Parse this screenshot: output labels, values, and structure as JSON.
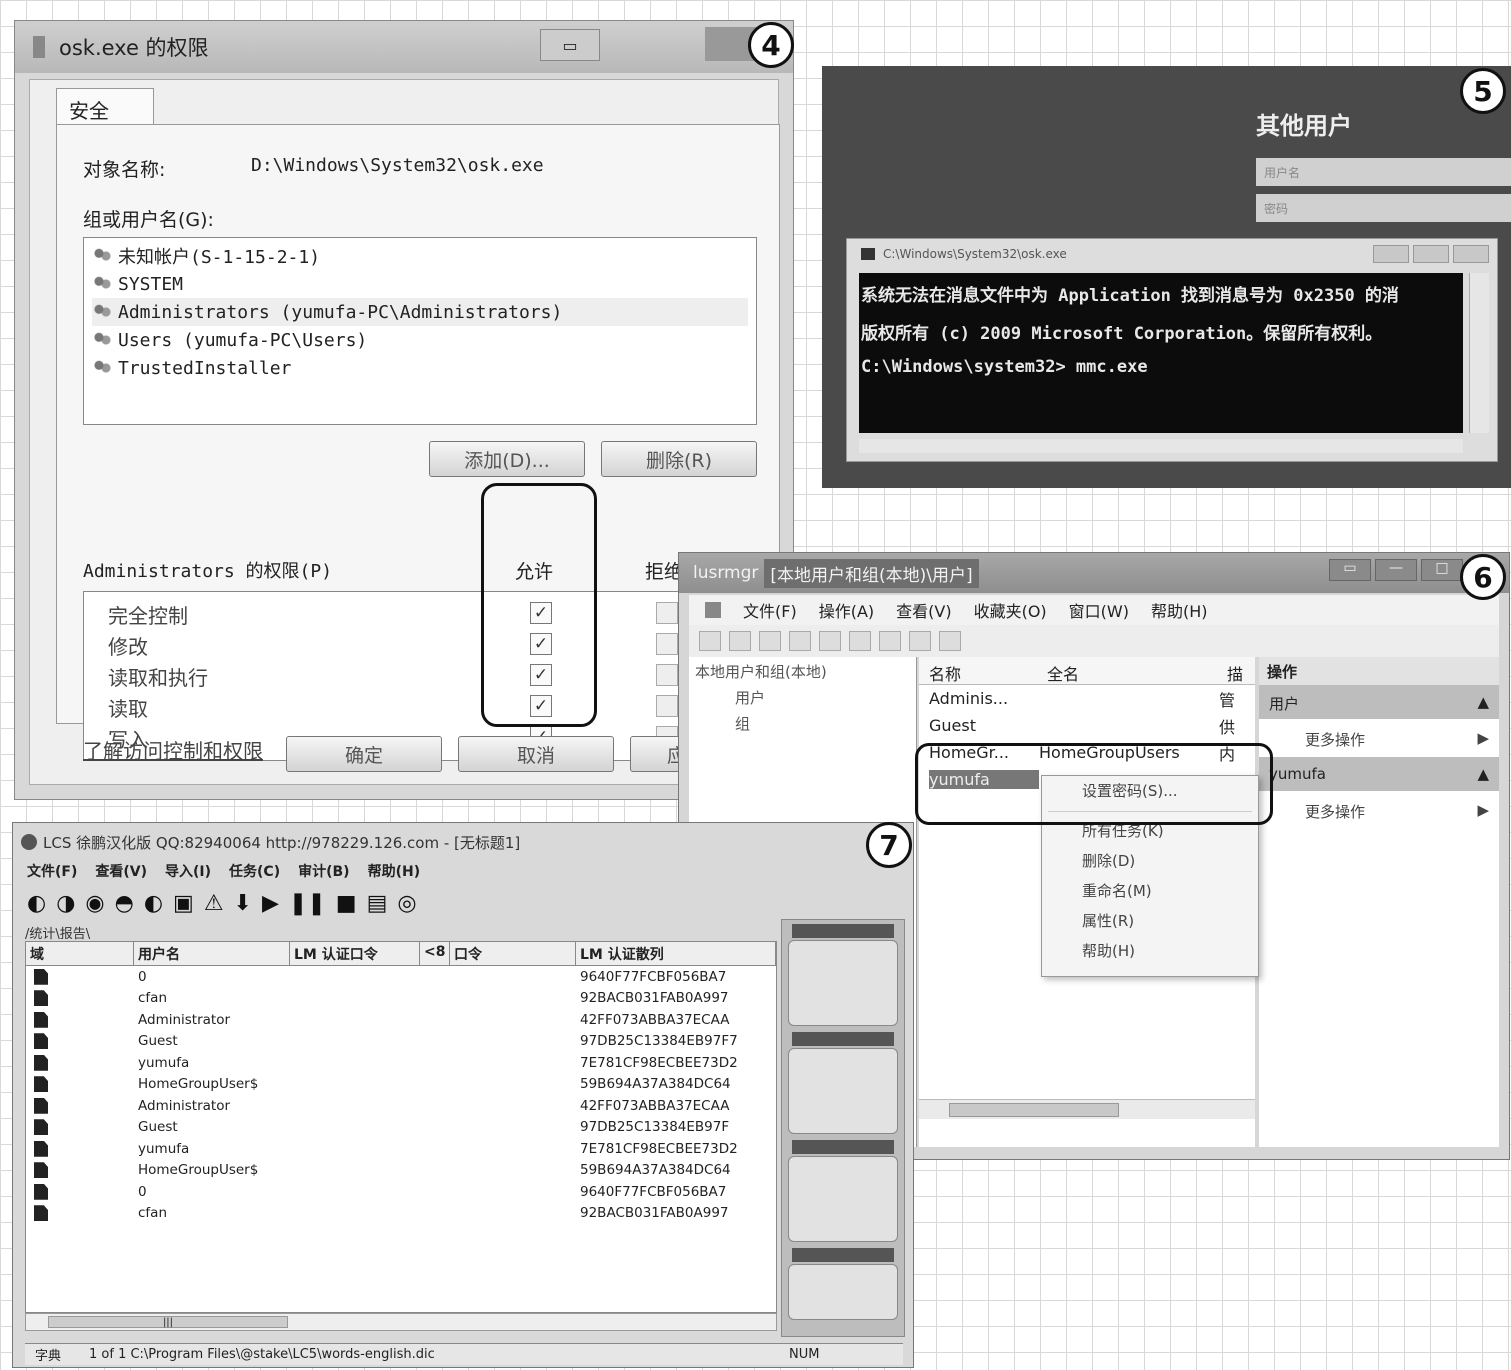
{
  "badges": [
    "4",
    "5",
    "6",
    "7"
  ],
  "panel4": {
    "title": "osk.exe 的权限",
    "close_glyph": "✕",
    "tab": "安全",
    "object_label": "对象名称:",
    "object_value": "D:\\Windows\\System32\\osk.exe",
    "group_label": "组或用户名(G):",
    "users": [
      "未知帐户(S-1-15-2-1)",
      "SYSTEM",
      "Administrators (yumufa-PC\\Administrators)",
      "Users (yumufa-PC\\Users)",
      "TrustedInstaller"
    ],
    "add_button": "添加(D)...",
    "remove_button": "删除(R)",
    "perm_label": "Administrators 的权限(P)",
    "allow_header": "允许",
    "deny_header": "拒绝",
    "permissions": [
      "完全控制",
      "修改",
      "读取和执行",
      "读取",
      "写入"
    ],
    "check_glyph": "✓",
    "learn_link": "了解访问控制和权限",
    "ok_button": "确定",
    "cancel_button": "取消",
    "apply_button": "应"
  },
  "panel5": {
    "other_user": "其他用户",
    "username_placeholder": "用户名",
    "password_placeholder": "密码",
    "cmd_title": "C:\\Windows\\System32\\osk.exe",
    "lines": [
      "系统无法在消息文件中为 Application 找到消息号为 0x2350 的消",
      "版权所有 (c) 2009 Microsoft Corporation。保留所有权利。",
      "C:\\Windows\\system32> mmc.exe"
    ]
  },
  "panel6": {
    "title_app": "lusrmgr",
    "title_path": "[本地用户和组(本地)\\用户]",
    "win_buttons": [
      "▭",
      "—",
      "□"
    ],
    "menu": [
      "文件(F)",
      "操作(A)",
      "查看(V)",
      "收藏夹(O)",
      "窗口(W)",
      "帮助(H)"
    ],
    "tree": [
      "本地用户和组(本地)",
      "用户",
      "组"
    ],
    "columns": [
      "名称",
      "全名",
      "描"
    ],
    "rows": [
      {
        "name": "Adminis...",
        "full": "",
        "desc": "管"
      },
      {
        "name": "Guest",
        "full": "",
        "desc": "供"
      },
      {
        "name": "HomeGr...",
        "full": "HomeGroupUsers",
        "desc": "内"
      },
      {
        "name": "yumufa",
        "full": "",
        "desc": ""
      }
    ],
    "actions_header": "操作",
    "actions": [
      {
        "group": "用户",
        "more": "更多操作"
      },
      {
        "group": "yumufa",
        "more": "更多操作"
      }
    ],
    "arrow_up": "▲",
    "arrow_right": "▶",
    "context_menu": [
      "设置密码(S)...",
      "所有任务(K)",
      "删除(D)",
      "重命名(M)",
      "属性(R)",
      "帮助(H)"
    ]
  },
  "panel7": {
    "title": "LCS 徐鹏汉化版 QQ:82940064 http://978229.126.com - [无标题1]",
    "menu": [
      "文件(F)",
      "查看(V)",
      "导入(I)",
      "任务(C)",
      "审计(B)",
      "帮助(H)"
    ],
    "toolbar_glyphs": [
      "◐",
      "◑",
      "◉",
      "◓",
      "◐",
      "▣",
      "⚠",
      "⬇",
      "▶",
      "❚❚",
      "■",
      "▤",
      "◎"
    ],
    "tabs": "/统计\\报告\\",
    "columns": [
      "域",
      "用户名",
      "LM 认证口令",
      "<8",
      "口令",
      "LM 认证散列"
    ],
    "rows": [
      {
        "user": "0",
        "hash": "9640F77FCBF056BA7"
      },
      {
        "user": "cfan",
        "hash": "92BACB031FAB0A997"
      },
      {
        "user": "Administrator",
        "hash": "42FF073ABBA37ECAA"
      },
      {
        "user": "Guest",
        "hash": "97DB25C13384EB97F7"
      },
      {
        "user": "yumufa",
        "hash": "7E781CF98ECBEE73D2"
      },
      {
        "user": "HomeGroupUser$",
        "hash": "59B694A37A384DC64"
      },
      {
        "user": "Administrator",
        "hash": "42FF073ABBA37ECAA"
      },
      {
        "user": "Guest",
        "hash": "97DB25C13384EB97F"
      },
      {
        "user": "yumufa",
        "hash": "7E781CF98ECBEE73D2"
      },
      {
        "user": "HomeGroupUser$",
        "hash": "59B694A37A384DC64"
      },
      {
        "user": "0",
        "hash": "9640F77FCBF056BA7"
      },
      {
        "user": "cfan",
        "hash": "92BACB031FAB0A997"
      }
    ],
    "scroll_thumb": "|||",
    "status_left": "字典",
    "status_mid": "1 of 1 C:\\Program Files\\@stake\\LC5\\words-english.dic",
    "status_right": "NUM"
  }
}
